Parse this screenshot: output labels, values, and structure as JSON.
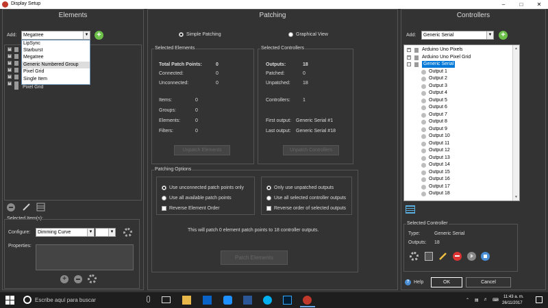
{
  "window": {
    "title": "Display Setup"
  },
  "elements": {
    "header": "Elements",
    "add_label": "Add:",
    "add_value": "Megatree",
    "dropdown_options": [
      "LipSync",
      "Starburst",
      "Megatree",
      "Generic Numbered Group",
      "Pixel Grid",
      "Single Item"
    ],
    "dropdown_selected_index": 3,
    "tree_items": [
      "Pixel Grid"
    ],
    "selected_items_label": "Selected Item(s):",
    "configure_label": "Configure:",
    "configure_value": "Dimming Curve",
    "properties_label": "Properties:"
  },
  "patching": {
    "header": "Patching",
    "mode_simple": "Simple Patching",
    "mode_graphical": "Graphical View",
    "selected_elements": {
      "title": "Selected Elements",
      "total_label": "Total Patch Points:",
      "total_value": "0",
      "connected_label": "Connected:",
      "connected_value": "0",
      "unconnected_label": "Unconnected:",
      "unconnected_value": "0",
      "items_label": "Items:",
      "items_value": "0",
      "groups_label": "Groups:",
      "groups_value": "0",
      "elements_label": "Elements:",
      "elements_value": "0",
      "filters_label": "Filters:",
      "filters_value": "0",
      "unpatch_button": "Unpatch Elements"
    },
    "selected_controllers": {
      "title": "Selected Controllers",
      "outputs_label": "Outputs:",
      "outputs_value": "18",
      "patched_label": "Patched:",
      "patched_value": "0",
      "unpatched_label": "Unpatched:",
      "unpatched_value": "18",
      "controllers_label": "Controllers:",
      "controllers_value": "1",
      "first_output_label": "First output:",
      "first_output_value": "Generic Serial #1",
      "last_output_label": "Last output:",
      "last_output_value": "Generic Serial #18",
      "unpatch_button": "Unpatch Controllers"
    },
    "options": {
      "title": "Patching Options",
      "left": [
        "Use unconnected patch points only",
        "Use all available patch points",
        "Reverse Element Order"
      ],
      "right": [
        "Only use unpatched outputs",
        "Use all selected controller outputs",
        "Reverse order of selected outputs"
      ]
    },
    "summary": "This will patch 0 element patch points to 18 controller outputs.",
    "patch_button": "Patch Elements"
  },
  "controllers": {
    "header": "Controllers",
    "add_label": "Add:",
    "add_value": "Generic Serial",
    "tree": [
      {
        "label": "Arduino Uno Pixels",
        "level": 0
      },
      {
        "label": "Arduino Uno Pixel Grid",
        "level": 0
      },
      {
        "label": "Generic Serial",
        "level": 0,
        "selected": true
      },
      {
        "label": "Output 1",
        "level": 1
      },
      {
        "label": "Output 2",
        "level": 1
      },
      {
        "label": "Output 3",
        "level": 1
      },
      {
        "label": "Output 4",
        "level": 1
      },
      {
        "label": "Output 5",
        "level": 1
      },
      {
        "label": "Output 6",
        "level": 1
      },
      {
        "label": "Output 7",
        "level": 1
      },
      {
        "label": "Output 8",
        "level": 1
      },
      {
        "label": "Output 9",
        "level": 1
      },
      {
        "label": "Output 10",
        "level": 1
      },
      {
        "label": "Output 11",
        "level": 1
      },
      {
        "label": "Output 12",
        "level": 1
      },
      {
        "label": "Output 13",
        "level": 1
      },
      {
        "label": "Output 14",
        "level": 1
      },
      {
        "label": "Output 15",
        "level": 1
      },
      {
        "label": "Output 16",
        "level": 1
      },
      {
        "label": "Output 17",
        "level": 1
      },
      {
        "label": "Output 18",
        "level": 1
      }
    ],
    "selected_controller": {
      "title": "Selected Controller",
      "type_label": "Type:",
      "type_value": "Generic Serial",
      "outputs_label": "Outputs:",
      "outputs_value": "18"
    }
  },
  "footer": {
    "help": "Help",
    "ok": "OK",
    "cancel": "Cancel"
  },
  "taskbar": {
    "search_placeholder": "Escribe aquí para buscar",
    "time": "11:43 a. m.",
    "date": "26/11/2017"
  }
}
